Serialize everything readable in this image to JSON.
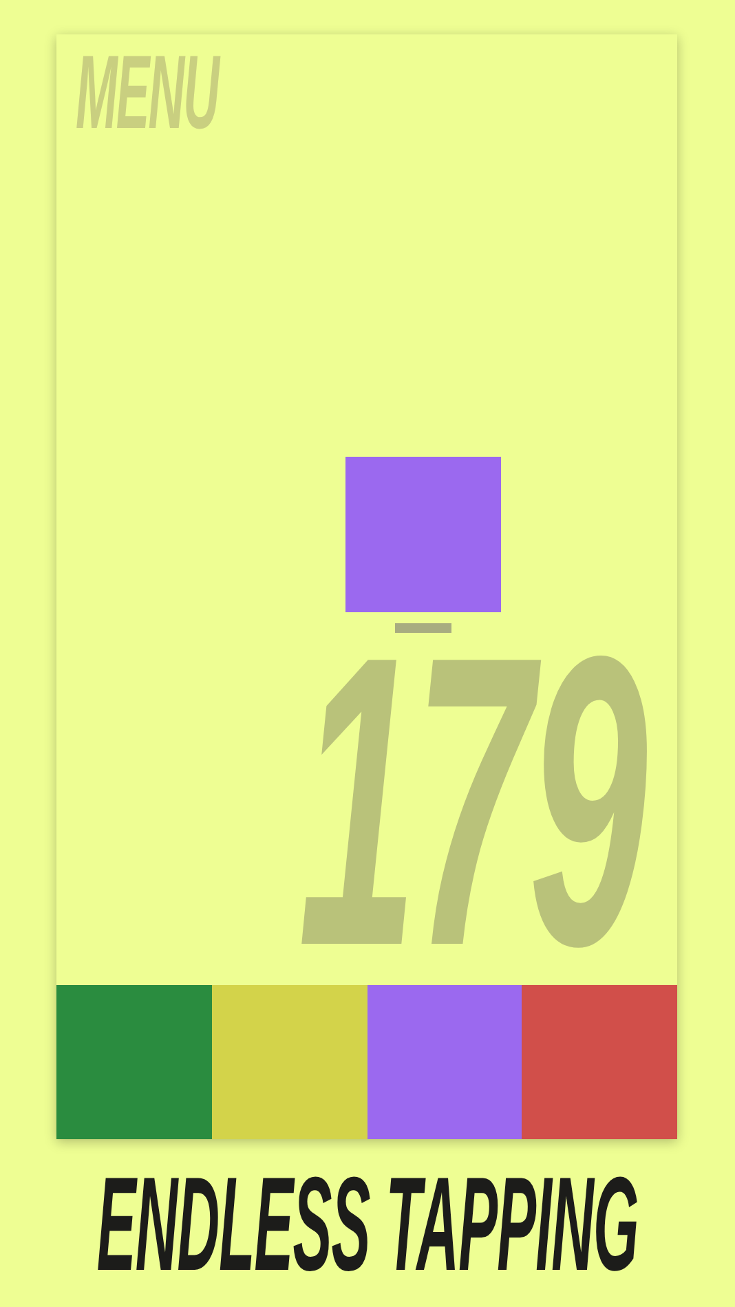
{
  "menu": {
    "label": "MENU"
  },
  "target": {
    "color": "#9b69ef"
  },
  "score": "179",
  "buttons": [
    {
      "color": "#2a8c3f"
    },
    {
      "color": "#d3d34a"
    },
    {
      "color": "#9b69ef"
    },
    {
      "color": "#d14f4a"
    }
  ],
  "tagline": "ENDLESS TAPPING"
}
